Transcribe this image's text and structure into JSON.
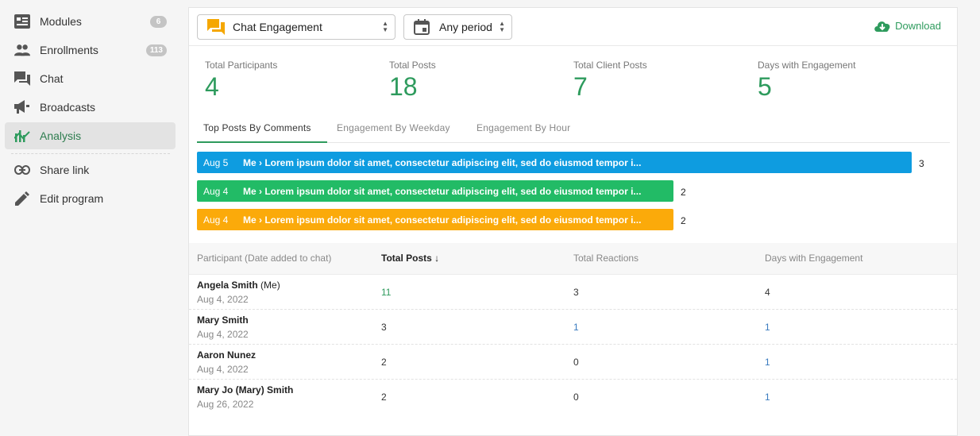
{
  "sidebar": {
    "items": [
      {
        "label": "Modules",
        "badge": "6",
        "icon": "modules-icon"
      },
      {
        "label": "Enrollments",
        "badge": "113",
        "icon": "people-icon"
      },
      {
        "label": "Chat",
        "icon": "chat-icon"
      },
      {
        "label": "Broadcasts",
        "icon": "megaphone-icon"
      },
      {
        "label": "Analysis",
        "icon": "analysis-icon"
      },
      {
        "label": "Share link",
        "icon": "link-icon"
      },
      {
        "label": "Edit program",
        "icon": "pencil-icon"
      }
    ]
  },
  "toolbar": {
    "report_select": "Chat Engagement",
    "period_select": "Any period",
    "download_label": "Download"
  },
  "stats": [
    {
      "label": "Total Participants",
      "value": "4"
    },
    {
      "label": "Total Posts",
      "value": "18"
    },
    {
      "label": "Total Client Posts",
      "value": "7"
    },
    {
      "label": "Days with Engagement",
      "value": "5"
    }
  ],
  "tabs": [
    {
      "label": "Top Posts By Comments"
    },
    {
      "label": "Engagement By Weekday"
    },
    {
      "label": "Engagement By Hour"
    }
  ],
  "top_posts": [
    {
      "date": "Aug 5",
      "text": "Me › Lorem ipsum dolor sit amet, consectetur adipiscing elit, sed do eiusmod tempor i...",
      "count": 3,
      "count_label": "3",
      "color": "#0e9ce0"
    },
    {
      "date": "Aug 4",
      "text": "Me › Lorem ipsum dolor sit amet, consectetur adipiscing elit, sed do eiusmod tempor i...",
      "count": 2,
      "count_label": "2",
      "color": "#22bb66"
    },
    {
      "date": "Aug 4",
      "text": "Me › Lorem ipsum dolor sit amet, consectetur adipiscing elit, sed do eiusmod tempor i...",
      "count": 2,
      "count_label": "2",
      "color": "#fbaa0a"
    }
  ],
  "table": {
    "headers": [
      "Participant (Date added to chat)",
      "Total Posts",
      "Total Reactions",
      "Days with Engagement"
    ],
    "rows": [
      {
        "name": "Angela Smith",
        "suffix": "(Me)",
        "date": "Aug 4, 2022",
        "posts": "11",
        "reactions": "3",
        "days": "4"
      },
      {
        "name": "Mary Smith",
        "suffix": "",
        "date": "Aug 4, 2022",
        "posts": "3",
        "reactions": "1",
        "days": "1"
      },
      {
        "name": "Aaron Nunez",
        "suffix": "",
        "date": "Aug 4, 2022",
        "posts": "2",
        "reactions": "0",
        "days": "1"
      },
      {
        "name": "Mary Jo (Mary) Smith",
        "suffix": "",
        "date": "Aug 26, 2022",
        "posts": "2",
        "reactions": "0",
        "days": "1"
      }
    ]
  },
  "colors": {
    "accent": "#2e9b5d",
    "link_blue": "#3a7bbf"
  }
}
